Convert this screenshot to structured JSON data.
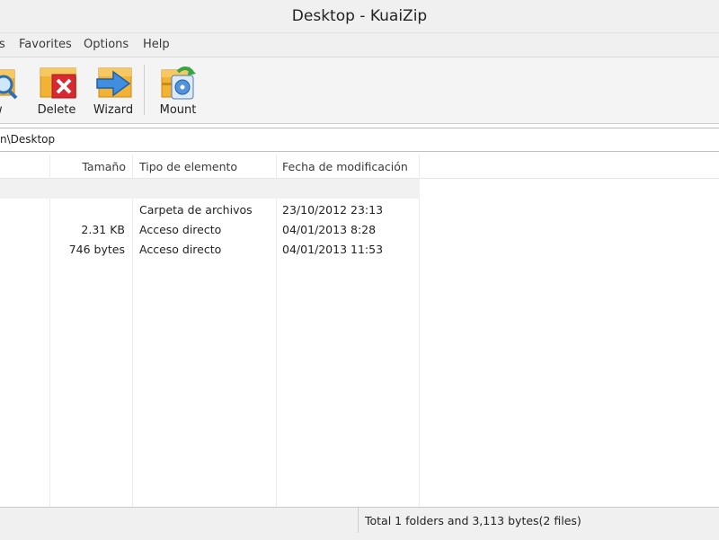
{
  "window": {
    "title": "Desktop - KuaiZip"
  },
  "menu": {
    "items": [
      {
        "label": "s"
      },
      {
        "label": "Favorites"
      },
      {
        "label": "Options"
      },
      {
        "label": "Help"
      }
    ]
  },
  "toolbar": {
    "view_label": "ew",
    "delete_label": "Delete",
    "wizard_label": "Wizard",
    "mount_label": "Mount"
  },
  "address": {
    "path": "n\\Desktop"
  },
  "columns": {
    "size": "Tamaño",
    "type": "Tipo de elemento",
    "modified": "Fecha de modificación"
  },
  "rows": [
    {
      "size": "",
      "type": "Carpeta de archivos",
      "modified": "23/10/2012 23:13"
    },
    {
      "size": "2.31 KB",
      "type": "Acceso directo",
      "modified": "04/01/2013 8:28"
    },
    {
      "size": "746 bytes",
      "type": "Acceso directo",
      "modified": "04/01/2013 11:53"
    }
  ],
  "status": {
    "text": "Total 1 folders and 3,113 bytes(2 files)"
  },
  "colors": {
    "folder_yellow": "#f2b233",
    "delete_red": "#d9282f",
    "wizard_blue": "#3f8ee0",
    "mount_green": "#3aa442"
  },
  "icons": {
    "view": "magnifier-icon",
    "delete": "delete-x-icon",
    "wizard": "arrow-right-icon",
    "mount": "disc-mount-icon"
  }
}
